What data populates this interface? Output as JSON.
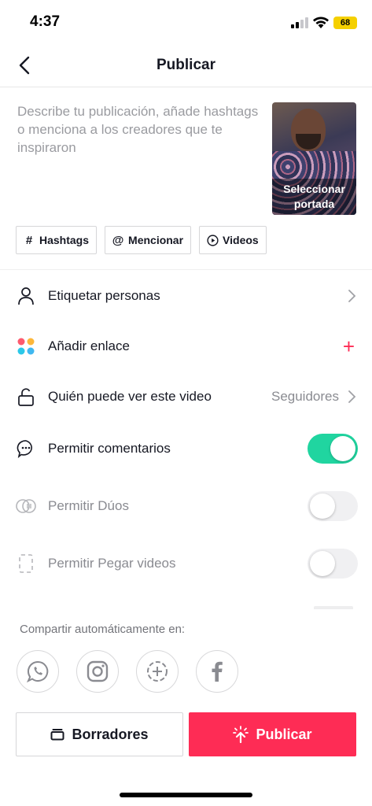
{
  "status": {
    "time": "4:37",
    "battery": "68"
  },
  "nav": {
    "title": "Publicar"
  },
  "caption": {
    "placeholder": "Describe tu publicación, añade hashtags o menciona a los creadores que te inspiraron"
  },
  "cover": {
    "label_line1": "Seleccionar",
    "label_line2": "portada"
  },
  "chips": [
    {
      "label": "Hashtags",
      "icon": "hash-icon"
    },
    {
      "label": "Mencionar",
      "icon": "at-icon"
    },
    {
      "label": "Videos",
      "icon": "play-circle-icon"
    }
  ],
  "settings": {
    "tag_people": {
      "label": "Etiquetar personas"
    },
    "add_link": {
      "label": "Añadir enlace"
    },
    "visibility": {
      "label": "Quién puede ver este video",
      "value": "Seguidores"
    },
    "comments": {
      "label": "Permitir comentarios",
      "enabled": true
    },
    "duets": {
      "label": "Permitir Dúos",
      "enabled": false
    },
    "stitch": {
      "label": "Permitir Pegar videos",
      "enabled": false
    }
  },
  "share": {
    "title": "Compartir automáticamente en:",
    "targets": [
      "whatsapp-icon",
      "instagram-icon",
      "status-add-icon",
      "facebook-icon"
    ]
  },
  "actions": {
    "drafts_label": "Borradores",
    "publish_label": "Publicar"
  },
  "colors": {
    "accent": "#fe2c55",
    "toggle_on": "#20d5a0",
    "battery": "#f5d000"
  }
}
